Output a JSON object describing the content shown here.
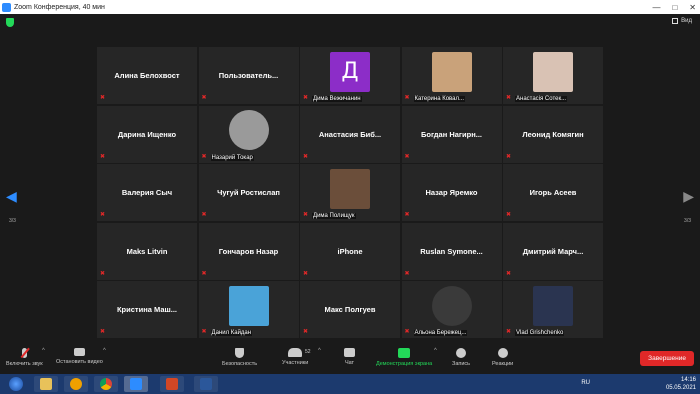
{
  "window": {
    "title": "Zoom Конференция, 40 мин"
  },
  "header": {
    "view_label": "Вид",
    "page_indicator_left": "3/3",
    "page_indicator_right": "3/3"
  },
  "tiles": [
    {
      "name": "Алина Белохвост",
      "type": "name"
    },
    {
      "name": "Пользователь...",
      "type": "name"
    },
    {
      "name": "Дима Вежичанин",
      "type": "letter",
      "letter": "Д"
    },
    {
      "name": "Катерина Ковал...",
      "type": "photo",
      "color": "#c9a27a"
    },
    {
      "name": "Анастасія Сотек...",
      "type": "photo",
      "color": "#d9c2b4"
    },
    {
      "name": "Дарина Ищенко",
      "type": "name"
    },
    {
      "name": "Назарий Токар",
      "type": "photo-round",
      "color": "#9a9a9a"
    },
    {
      "name": "Анастасия Биб...",
      "type": "name"
    },
    {
      "name": "Богдан Нагирн...",
      "type": "name"
    },
    {
      "name": "Леонид Комягин",
      "type": "name"
    },
    {
      "name": "Валерия Сыч",
      "type": "name"
    },
    {
      "name": "Чугуй Ростислап",
      "type": "name"
    },
    {
      "name": "Дима Полищук",
      "type": "photo",
      "color": "#6b4e3a"
    },
    {
      "name": "Назар Яремко",
      "type": "name"
    },
    {
      "name": "Игорь Асеев",
      "type": "name"
    },
    {
      "name": "Maks Litvin",
      "type": "name"
    },
    {
      "name": "Гончаров Назар",
      "type": "name"
    },
    {
      "name": "iPhone",
      "type": "name"
    },
    {
      "name": "Ruslan Symone...",
      "type": "name"
    },
    {
      "name": "Дмитрий Марч...",
      "type": "name"
    },
    {
      "name": "Кристина Маш...",
      "type": "name"
    },
    {
      "name": "Данил Кайдан",
      "type": "photo",
      "color": "#4aa3d8"
    },
    {
      "name": "Макс Полгуев",
      "type": "name"
    },
    {
      "name": "Альона Бережец...",
      "type": "photo-round",
      "color": "#3a3a3a"
    },
    {
      "name": "Vlad Grishchenko",
      "type": "photo",
      "color": "#2a3450"
    }
  ],
  "toolbar": {
    "unmute": "Включить звук",
    "stop_video": "Остановить видео",
    "security": "Безопасность",
    "participants": "Участники",
    "participants_count": "52",
    "chat": "Чат",
    "share": "Демонстрация экрана",
    "record": "Запись",
    "reactions": "Реакции",
    "end": "Завершение"
  },
  "taskbar": {
    "lang": "RU",
    "time": "14:16",
    "date": "05.05.2021"
  },
  "colors": {
    "accent": "#2d8cff",
    "end": "#e02828",
    "share": "#23d959"
  }
}
